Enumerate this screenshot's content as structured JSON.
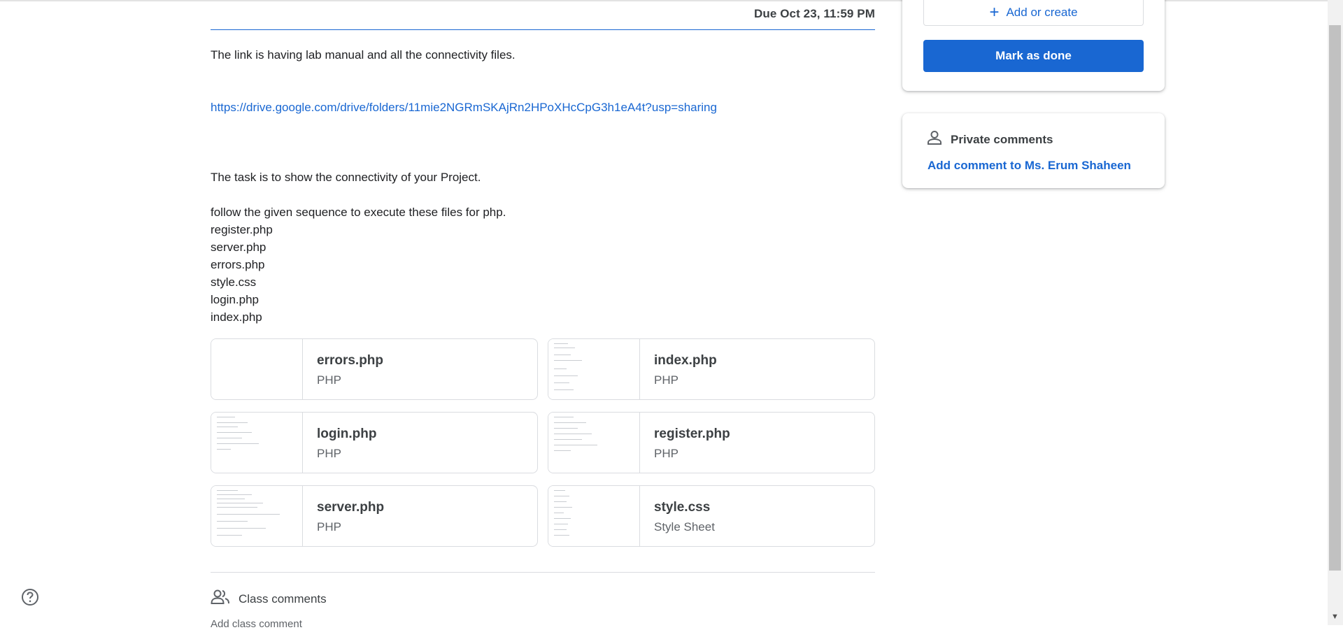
{
  "assignment": {
    "due": "Due Oct 23, 11:59 PM",
    "description": {
      "intro": "The link is having lab manual and all the connectivity files.",
      "link": "https://drive.google.com/drive/folders/11mie2NGRmSKAjRn2HPoXHcCpG3h1eA4t?usp=sharing",
      "task": "The task is to show the connectivity of your Project.",
      "sequence_intro": "follow the given sequence to execute these files for php.",
      "sequence": [
        "register.php",
        "server.php",
        "errors.php",
        "style.css",
        "login.php",
        "index.php"
      ]
    },
    "attachments": [
      {
        "name": "errors.php",
        "type": "PHP"
      },
      {
        "name": "index.php",
        "type": "PHP"
      },
      {
        "name": "login.php",
        "type": "PHP"
      },
      {
        "name": "register.php",
        "type": "PHP"
      },
      {
        "name": "server.php",
        "type": "PHP"
      },
      {
        "name": "style.css",
        "type": "Style Sheet"
      }
    ],
    "class_comments_label": "Class comments",
    "add_class_comment": "Add class comment"
  },
  "your_work": {
    "add_or_create_label": "Add or create",
    "mark_as_done_label": "Mark as done"
  },
  "private_comments": {
    "title": "Private comments",
    "add_link": "Add comment to Ms. Erum Shaheen"
  },
  "colors": {
    "accent": "#1967d2",
    "text": "#3c4043",
    "border": "#dadce0"
  }
}
